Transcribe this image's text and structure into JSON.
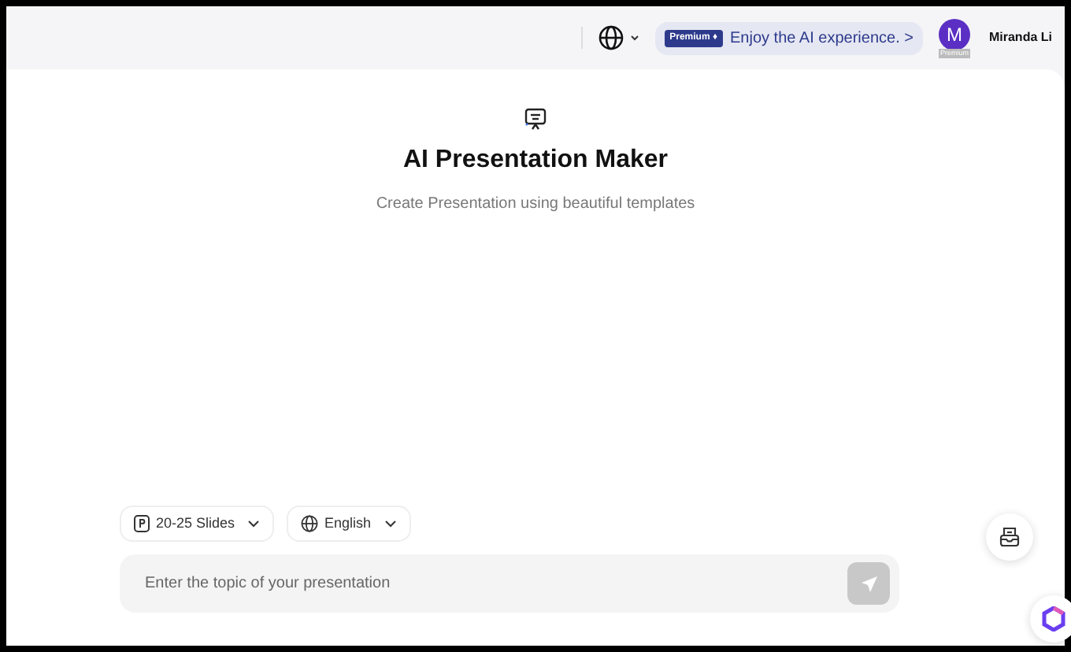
{
  "header": {
    "premium_badge": "Premium ♦",
    "promo": "Enjoy the AI experience. >",
    "user": {
      "initial": "M",
      "badge": "Premium",
      "name": "Miranda Li"
    }
  },
  "hero": {
    "title": "AI Presentation Maker",
    "subtitle": "Create Presentation using beautiful templates"
  },
  "options": [
    {
      "kind": "slides",
      "label": "20-25 Slides"
    },
    {
      "kind": "language",
      "label": "English"
    }
  ],
  "prompt": {
    "placeholder": "Enter the topic of your presentation",
    "send_disabled": true
  }
}
